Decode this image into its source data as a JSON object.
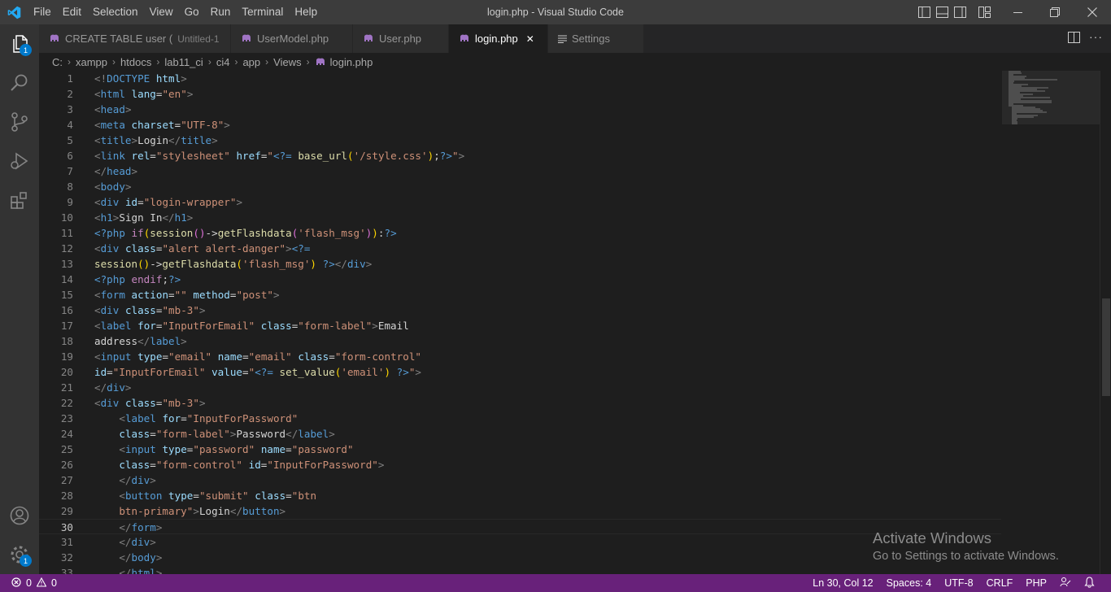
{
  "window": {
    "title": "login.php - Visual Studio Code",
    "menu": [
      "File",
      "Edit",
      "Selection",
      "View",
      "Go",
      "Run",
      "Terminal",
      "Help"
    ]
  },
  "activity_bar": {
    "explorer_badge": "1",
    "manage_badge": "1"
  },
  "tabs": [
    {
      "label": "CREATE TABLE user (",
      "description": "Untitled-1",
      "dirty": true,
      "active": false,
      "icon": "elephant-icon"
    },
    {
      "label": "UserModel.php",
      "active": false,
      "icon": "elephant-icon"
    },
    {
      "label": "User.php",
      "active": false,
      "icon": "elephant-icon"
    },
    {
      "label": "login.php",
      "active": true,
      "icon": "elephant-icon"
    },
    {
      "label": "Settings",
      "active": false,
      "icon": "settings-list-icon"
    }
  ],
  "breadcrumb": [
    "C:",
    "xampp",
    "htdocs",
    "lab11_ci",
    "ci4",
    "app",
    "Views",
    "login.php"
  ],
  "editor": {
    "current_line": 30,
    "lines": [
      [
        {
          "c": "brk",
          "t": "<!"
        },
        {
          "c": "tag",
          "t": "DOCTYPE"
        },
        {
          "c": "txt",
          "t": " "
        },
        {
          "c": "attr",
          "t": "html"
        },
        {
          "c": "brk",
          "t": ">"
        }
      ],
      [
        {
          "c": "brk",
          "t": "<"
        },
        {
          "c": "tag",
          "t": "html"
        },
        {
          "c": "txt",
          "t": " "
        },
        {
          "c": "attr",
          "t": "lang"
        },
        {
          "c": "txt",
          "t": "="
        },
        {
          "c": "str",
          "t": "\"en\""
        },
        {
          "c": "brk",
          "t": ">"
        }
      ],
      [
        {
          "c": "brk",
          "t": "<"
        },
        {
          "c": "tag",
          "t": "head"
        },
        {
          "c": "brk",
          "t": ">"
        }
      ],
      [
        {
          "c": "brk",
          "t": "<"
        },
        {
          "c": "tag",
          "t": "meta"
        },
        {
          "c": "txt",
          "t": " "
        },
        {
          "c": "attr",
          "t": "charset"
        },
        {
          "c": "txt",
          "t": "="
        },
        {
          "c": "str",
          "t": "\"UTF-8\""
        },
        {
          "c": "brk",
          "t": ">"
        }
      ],
      [
        {
          "c": "brk",
          "t": "<"
        },
        {
          "c": "tag",
          "t": "title"
        },
        {
          "c": "brk",
          "t": ">"
        },
        {
          "c": "txt",
          "t": "Login"
        },
        {
          "c": "brk",
          "t": "</"
        },
        {
          "c": "tag",
          "t": "title"
        },
        {
          "c": "brk",
          "t": ">"
        }
      ],
      [
        {
          "c": "brk",
          "t": "<"
        },
        {
          "c": "tag",
          "t": "link"
        },
        {
          "c": "txt",
          "t": " "
        },
        {
          "c": "attr",
          "t": "rel"
        },
        {
          "c": "txt",
          "t": "="
        },
        {
          "c": "str",
          "t": "\"stylesheet\""
        },
        {
          "c": "txt",
          "t": " "
        },
        {
          "c": "attr",
          "t": "href"
        },
        {
          "c": "txt",
          "t": "="
        },
        {
          "c": "str",
          "t": "\""
        },
        {
          "c": "php",
          "t": "<?="
        },
        {
          "c": "txt",
          "t": " "
        },
        {
          "c": "fn",
          "t": "base_url"
        },
        {
          "c": "p1",
          "t": "("
        },
        {
          "c": "str",
          "t": "'/style.css'"
        },
        {
          "c": "p1",
          "t": ")"
        },
        {
          "c": "txt",
          "t": ";"
        },
        {
          "c": "php",
          "t": "?>"
        },
        {
          "c": "str",
          "t": "\""
        },
        {
          "c": "brk",
          "t": ">"
        }
      ],
      [
        {
          "c": "brk",
          "t": "</"
        },
        {
          "c": "tag",
          "t": "head"
        },
        {
          "c": "brk",
          "t": ">"
        }
      ],
      [
        {
          "c": "brk",
          "t": "<"
        },
        {
          "c": "tag",
          "t": "body"
        },
        {
          "c": "brk",
          "t": ">"
        }
      ],
      [
        {
          "c": "brk",
          "t": "<"
        },
        {
          "c": "tag",
          "t": "div"
        },
        {
          "c": "txt",
          "t": " "
        },
        {
          "c": "attr",
          "t": "id"
        },
        {
          "c": "txt",
          "t": "="
        },
        {
          "c": "str",
          "t": "\"login-wrapper\""
        },
        {
          "c": "brk",
          "t": ">"
        }
      ],
      [
        {
          "c": "brk",
          "t": "<"
        },
        {
          "c": "tag",
          "t": "h1"
        },
        {
          "c": "brk",
          "t": ">"
        },
        {
          "c": "txt",
          "t": "Sign In"
        },
        {
          "c": "brk",
          "t": "</"
        },
        {
          "c": "tag",
          "t": "h1"
        },
        {
          "c": "brk",
          "t": ">"
        }
      ],
      [
        {
          "c": "php",
          "t": "<?php"
        },
        {
          "c": "txt",
          "t": " "
        },
        {
          "c": "kw",
          "t": "if"
        },
        {
          "c": "p1",
          "t": "("
        },
        {
          "c": "fn",
          "t": "session"
        },
        {
          "c": "p2",
          "t": "()"
        },
        {
          "c": "txt",
          "t": "->"
        },
        {
          "c": "fn",
          "t": "getFlashdata"
        },
        {
          "c": "p2",
          "t": "("
        },
        {
          "c": "str",
          "t": "'flash_msg'"
        },
        {
          "c": "p2",
          "t": ")"
        },
        {
          "c": "p1",
          "t": ")"
        },
        {
          "c": "txt",
          "t": ":"
        },
        {
          "c": "php",
          "t": "?>"
        }
      ],
      [
        {
          "c": "brk",
          "t": "<"
        },
        {
          "c": "tag",
          "t": "div"
        },
        {
          "c": "txt",
          "t": " "
        },
        {
          "c": "attr",
          "t": "class"
        },
        {
          "c": "txt",
          "t": "="
        },
        {
          "c": "str",
          "t": "\"alert alert-danger\""
        },
        {
          "c": "brk",
          "t": ">"
        },
        {
          "c": "php",
          "t": "<?="
        }
      ],
      [
        {
          "c": "fn",
          "t": "session"
        },
        {
          "c": "p1",
          "t": "()"
        },
        {
          "c": "txt",
          "t": "->"
        },
        {
          "c": "fn",
          "t": "getFlashdata"
        },
        {
          "c": "p1",
          "t": "("
        },
        {
          "c": "str",
          "t": "'flash_msg'"
        },
        {
          "c": "p1",
          "t": ")"
        },
        {
          "c": "txt",
          "t": " "
        },
        {
          "c": "php",
          "t": "?>"
        },
        {
          "c": "brk",
          "t": "</"
        },
        {
          "c": "tag",
          "t": "div"
        },
        {
          "c": "brk",
          "t": ">"
        }
      ],
      [
        {
          "c": "php",
          "t": "<?php"
        },
        {
          "c": "txt",
          "t": " "
        },
        {
          "c": "kw",
          "t": "endif"
        },
        {
          "c": "txt",
          "t": ";"
        },
        {
          "c": "php",
          "t": "?>"
        }
      ],
      [
        {
          "c": "brk",
          "t": "<"
        },
        {
          "c": "tag",
          "t": "form"
        },
        {
          "c": "txt",
          "t": " "
        },
        {
          "c": "attr",
          "t": "action"
        },
        {
          "c": "txt",
          "t": "="
        },
        {
          "c": "str",
          "t": "\"\""
        },
        {
          "c": "txt",
          "t": " "
        },
        {
          "c": "attr",
          "t": "method"
        },
        {
          "c": "txt",
          "t": "="
        },
        {
          "c": "str",
          "t": "\"post\""
        },
        {
          "c": "brk",
          "t": ">"
        }
      ],
      [
        {
          "c": "brk",
          "t": "<"
        },
        {
          "c": "tag",
          "t": "div"
        },
        {
          "c": "txt",
          "t": " "
        },
        {
          "c": "attr",
          "t": "class"
        },
        {
          "c": "txt",
          "t": "="
        },
        {
          "c": "str",
          "t": "\"mb-3\""
        },
        {
          "c": "brk",
          "t": ">"
        }
      ],
      [
        {
          "c": "brk",
          "t": "<"
        },
        {
          "c": "tag",
          "t": "label"
        },
        {
          "c": "txt",
          "t": " "
        },
        {
          "c": "attr",
          "t": "for"
        },
        {
          "c": "txt",
          "t": "="
        },
        {
          "c": "str",
          "t": "\"InputForEmail\""
        },
        {
          "c": "txt",
          "t": " "
        },
        {
          "c": "attr",
          "t": "class"
        },
        {
          "c": "txt",
          "t": "="
        },
        {
          "c": "str",
          "t": "\"form-label\""
        },
        {
          "c": "brk",
          "t": ">"
        },
        {
          "c": "txt",
          "t": "Email"
        }
      ],
      [
        {
          "c": "txt",
          "t": "address"
        },
        {
          "c": "brk",
          "t": "</"
        },
        {
          "c": "tag",
          "t": "label"
        },
        {
          "c": "brk",
          "t": ">"
        }
      ],
      [
        {
          "c": "brk",
          "t": "<"
        },
        {
          "c": "tag",
          "t": "input"
        },
        {
          "c": "txt",
          "t": " "
        },
        {
          "c": "attr",
          "t": "type"
        },
        {
          "c": "txt",
          "t": "="
        },
        {
          "c": "str",
          "t": "\"email\""
        },
        {
          "c": "txt",
          "t": " "
        },
        {
          "c": "attr",
          "t": "name"
        },
        {
          "c": "txt",
          "t": "="
        },
        {
          "c": "str",
          "t": "\"email\""
        },
        {
          "c": "txt",
          "t": " "
        },
        {
          "c": "attr",
          "t": "class"
        },
        {
          "c": "txt",
          "t": "="
        },
        {
          "c": "str",
          "t": "\"form-control\""
        }
      ],
      [
        {
          "c": "attr",
          "t": "id"
        },
        {
          "c": "txt",
          "t": "="
        },
        {
          "c": "str",
          "t": "\"InputForEmail\""
        },
        {
          "c": "txt",
          "t": " "
        },
        {
          "c": "attr",
          "t": "value"
        },
        {
          "c": "txt",
          "t": "="
        },
        {
          "c": "str",
          "t": "\""
        },
        {
          "c": "php",
          "t": "<?="
        },
        {
          "c": "txt",
          "t": " "
        },
        {
          "c": "fn",
          "t": "set_value"
        },
        {
          "c": "p1",
          "t": "("
        },
        {
          "c": "str",
          "t": "'email'"
        },
        {
          "c": "p1",
          "t": ")"
        },
        {
          "c": "txt",
          "t": " "
        },
        {
          "c": "php",
          "t": "?>"
        },
        {
          "c": "str",
          "t": "\""
        },
        {
          "c": "brk",
          "t": ">"
        }
      ],
      [
        {
          "c": "brk",
          "t": "</"
        },
        {
          "c": "tag",
          "t": "div"
        },
        {
          "c": "brk",
          "t": ">"
        }
      ],
      [
        {
          "c": "brk",
          "t": "<"
        },
        {
          "c": "tag",
          "t": "div"
        },
        {
          "c": "txt",
          "t": " "
        },
        {
          "c": "attr",
          "t": "class"
        },
        {
          "c": "txt",
          "t": "="
        },
        {
          "c": "str",
          "t": "\"mb-3\""
        },
        {
          "c": "brk",
          "t": ">"
        }
      ],
      [
        {
          "c": "txt",
          "t": "    "
        },
        {
          "c": "brk",
          "t": "<"
        },
        {
          "c": "tag",
          "t": "label"
        },
        {
          "c": "txt",
          "t": " "
        },
        {
          "c": "attr",
          "t": "for"
        },
        {
          "c": "txt",
          "t": "="
        },
        {
          "c": "str",
          "t": "\"InputForPassword\""
        }
      ],
      [
        {
          "c": "txt",
          "t": "    "
        },
        {
          "c": "attr",
          "t": "class"
        },
        {
          "c": "txt",
          "t": "="
        },
        {
          "c": "str",
          "t": "\"form-label\""
        },
        {
          "c": "brk",
          "t": ">"
        },
        {
          "c": "txt",
          "t": "Password"
        },
        {
          "c": "brk",
          "t": "</"
        },
        {
          "c": "tag",
          "t": "label"
        },
        {
          "c": "brk",
          "t": ">"
        }
      ],
      [
        {
          "c": "txt",
          "t": "    "
        },
        {
          "c": "brk",
          "t": "<"
        },
        {
          "c": "tag",
          "t": "input"
        },
        {
          "c": "txt",
          "t": " "
        },
        {
          "c": "attr",
          "t": "type"
        },
        {
          "c": "txt",
          "t": "="
        },
        {
          "c": "str",
          "t": "\"password\""
        },
        {
          "c": "txt",
          "t": " "
        },
        {
          "c": "attr",
          "t": "name"
        },
        {
          "c": "txt",
          "t": "="
        },
        {
          "c": "str",
          "t": "\"password\""
        }
      ],
      [
        {
          "c": "txt",
          "t": "    "
        },
        {
          "c": "attr",
          "t": "class"
        },
        {
          "c": "txt",
          "t": "="
        },
        {
          "c": "str",
          "t": "\"form-control\""
        },
        {
          "c": "txt",
          "t": " "
        },
        {
          "c": "attr",
          "t": "id"
        },
        {
          "c": "txt",
          "t": "="
        },
        {
          "c": "str",
          "t": "\"InputForPassword\""
        },
        {
          "c": "brk",
          "t": ">"
        }
      ],
      [
        {
          "c": "txt",
          "t": "    "
        },
        {
          "c": "brk",
          "t": "</"
        },
        {
          "c": "tag",
          "t": "div"
        },
        {
          "c": "brk",
          "t": ">"
        }
      ],
      [
        {
          "c": "txt",
          "t": "    "
        },
        {
          "c": "brk",
          "t": "<"
        },
        {
          "c": "tag",
          "t": "button"
        },
        {
          "c": "txt",
          "t": " "
        },
        {
          "c": "attr",
          "t": "type"
        },
        {
          "c": "txt",
          "t": "="
        },
        {
          "c": "str",
          "t": "\"submit\""
        },
        {
          "c": "txt",
          "t": " "
        },
        {
          "c": "attr",
          "t": "class"
        },
        {
          "c": "txt",
          "t": "="
        },
        {
          "c": "str",
          "t": "\"btn"
        }
      ],
      [
        {
          "c": "txt",
          "t": "    "
        },
        {
          "c": "str",
          "t": "btn-primary\""
        },
        {
          "c": "brk",
          "t": ">"
        },
        {
          "c": "txt",
          "t": "Login"
        },
        {
          "c": "brk",
          "t": "</"
        },
        {
          "c": "tag",
          "t": "button"
        },
        {
          "c": "brk",
          "t": ">"
        }
      ],
      [
        {
          "c": "txt",
          "t": "    "
        },
        {
          "c": "brk",
          "t": "</"
        },
        {
          "c": "tag",
          "t": "form"
        },
        {
          "c": "brk",
          "t": ">"
        }
      ],
      [
        {
          "c": "txt",
          "t": "    "
        },
        {
          "c": "brk",
          "t": "</"
        },
        {
          "c": "tag",
          "t": "div"
        },
        {
          "c": "brk",
          "t": ">"
        }
      ],
      [
        {
          "c": "txt",
          "t": "    "
        },
        {
          "c": "brk",
          "t": "</"
        },
        {
          "c": "tag",
          "t": "body"
        },
        {
          "c": "brk",
          "t": ">"
        }
      ],
      [
        {
          "c": "txt",
          "t": "    "
        },
        {
          "c": "brk",
          "t": "</"
        },
        {
          "c": "tag",
          "t": "html"
        },
        {
          "c": "brk",
          "t": ">"
        }
      ]
    ]
  },
  "watermark": {
    "line1": "Activate Windows",
    "line2": "Go to Settings to activate Windows."
  },
  "status_bar": {
    "errors": "0",
    "warnings": "0",
    "position": "Ln 30, Col 12",
    "spaces": "Spaces: 4",
    "encoding": "UTF-8",
    "eol": "CRLF",
    "language": "PHP"
  },
  "colors": {
    "status_bar_bg": "#68217a",
    "accent": "#007acc",
    "php_icon": "#a074c4"
  }
}
